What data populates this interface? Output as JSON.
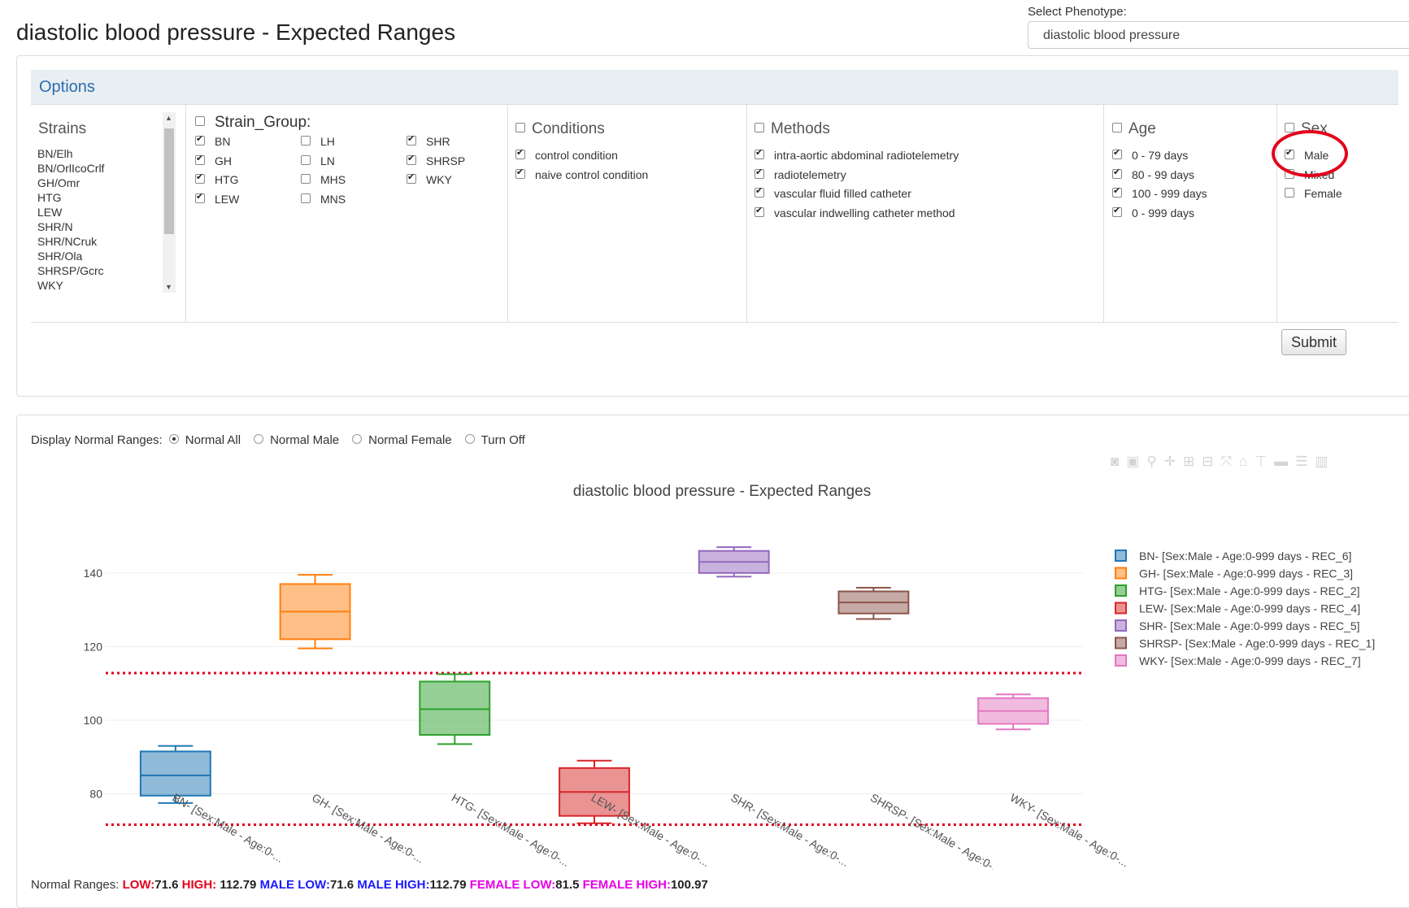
{
  "header": {
    "title": "diastolic blood pressure - Expected Ranges",
    "phenotype_label": "Select Phenotype:",
    "phenotype_value": "diastolic blood pressure",
    "caret": "▼"
  },
  "options": {
    "title": "Options",
    "strains": {
      "title": "Strains",
      "items": [
        "BN/Elh",
        "BN/OrlIcoCrlf",
        "GH/Omr",
        "HTG",
        "LEW",
        "SHR/N",
        "SHR/NCruk",
        "SHR/Ola",
        "SHRSP/Gcrc",
        "WKY"
      ]
    },
    "strain_group": {
      "title": "Strain_Group:",
      "checked": false,
      "items": [
        {
          "label": "BN",
          "checked": true
        },
        {
          "label": "GH",
          "checked": true
        },
        {
          "label": "HTG",
          "checked": true
        },
        {
          "label": "LEW",
          "checked": true
        },
        {
          "label": "LH",
          "checked": false
        },
        {
          "label": "LN",
          "checked": false
        },
        {
          "label": "MHS",
          "checked": false
        },
        {
          "label": "MNS",
          "checked": false
        },
        {
          "label": "SHR",
          "checked": true
        },
        {
          "label": "SHRSP",
          "checked": true
        },
        {
          "label": "WKY",
          "checked": true
        }
      ]
    },
    "conditions": {
      "title": "Conditions",
      "checked": false,
      "items": [
        {
          "label": "control condition",
          "checked": true
        },
        {
          "label": "naive control condition",
          "checked": true
        }
      ]
    },
    "methods": {
      "title": "Methods",
      "checked": false,
      "items": [
        {
          "label": "intra-aortic abdominal radiotelemetry",
          "checked": true
        },
        {
          "label": "radiotelemetry",
          "checked": true
        },
        {
          "label": "vascular fluid filled catheter",
          "checked": true
        },
        {
          "label": "vascular indwelling catheter method",
          "checked": true
        }
      ]
    },
    "age": {
      "title": "Age",
      "checked": false,
      "items": [
        {
          "label": "0 - 79 days",
          "checked": true
        },
        {
          "label": "80 - 99 days",
          "checked": true
        },
        {
          "label": "100 - 999 days",
          "checked": true
        },
        {
          "label": "0 - 999 days",
          "checked": true
        }
      ]
    },
    "sex": {
      "title": "Sex",
      "checked": false,
      "items": [
        {
          "label": "Male",
          "checked": true
        },
        {
          "label": "Mixed",
          "checked": false
        },
        {
          "label": "Female",
          "checked": false
        }
      ]
    },
    "submit_label": "Submit"
  },
  "display": {
    "label": "Display Normal Ranges:",
    "options": [
      {
        "label": "Normal All",
        "selected": true
      },
      {
        "label": "Normal Male",
        "selected": false
      },
      {
        "label": "Normal Female",
        "selected": false
      },
      {
        "label": "Turn Off",
        "selected": false
      }
    ]
  },
  "modebar_icons": [
    "camera-icon",
    "save-icon",
    "zoom-icon",
    "pan-icon",
    "zoom-in-icon",
    "zoom-out-icon",
    "autoscale-icon",
    "home-icon",
    "spike-icon",
    "hover-closest-icon",
    "hover-compare-icon",
    "plotly-logo-icon"
  ],
  "chart_data": {
    "type": "box",
    "title": "diastolic blood pressure - Expected Ranges",
    "y_ticks": [
      80,
      100,
      120,
      140
    ],
    "ylim": [
      62,
      153
    ],
    "grid": true,
    "legend_position": "right",
    "reference_lines": [
      {
        "name": "HIGH",
        "value": 112.79,
        "color": "#e3001b",
        "style": "dotted"
      },
      {
        "name": "LOW",
        "value": 71.6,
        "color": "#e3001b",
        "style": "dotted"
      }
    ],
    "series": [
      {
        "name": "BN- [Sex:Male - Age:0-999 days - REC_6]",
        "tick": "BN- [Sex:Male - Age:0-...",
        "color": "#1f77b4",
        "min": 77.5,
        "q1": 79.5,
        "median": 85,
        "q3": 91.5,
        "max": 93
      },
      {
        "name": "GH- [Sex:Male - Age:0-999 days - REC_3]",
        "tick": "GH- [Sex:Male - Age:0-...",
        "color": "#ff7f0e",
        "min": 119.5,
        "q1": 122,
        "median": 129.5,
        "q3": 137,
        "max": 139.5
      },
      {
        "name": "HTG- [Sex:Male - Age:0-999 days - REC_2]",
        "tick": "HTG- [Sex:Male - Age:0-...",
        "color": "#2ca02c",
        "min": 93.5,
        "q1": 96,
        "median": 103,
        "q3": 110.5,
        "max": 112.5
      },
      {
        "name": "LEW- [Sex:Male - Age:0-999 days - REC_4]",
        "tick": "LEW- [Sex:Male - Age:0-...",
        "color": "#d62728",
        "min": 72,
        "q1": 74,
        "median": 80.5,
        "q3": 87,
        "max": 89
      },
      {
        "name": "SHR- [Sex:Male - Age:0-999 days - REC_5]",
        "tick": "SHR- [Sex:Male - Age:0-...",
        "color": "#9467bd",
        "min": 139,
        "q1": 140,
        "median": 143,
        "q3": 146,
        "max": 147
      },
      {
        "name": "SHRSP- [Sex:Male - Age:0-999 days - REC_1]",
        "tick": "SHRSP- [Sex:Male - Age:0-...",
        "color": "#8c564b",
        "min": 127.5,
        "q1": 129,
        "median": 132,
        "q3": 135,
        "max": 136
      },
      {
        "name": "WKY- [Sex:Male - Age:0-999 days - REC_7]",
        "tick": "WKY- [Sex:Male - Age:0-...",
        "color": "#e377c2",
        "min": 97.5,
        "q1": 99,
        "median": 102.5,
        "q3": 106,
        "max": 107
      }
    ]
  },
  "footer": {
    "label": "Normal Ranges:",
    "low_label": "LOW:",
    "low_value": "71.6",
    "high_label": "HIGH:",
    "high_value": "112.79",
    "male_low_label": "MALE LOW:",
    "male_low_value": "71.6",
    "male_high_label": "MALE HIGH:",
    "male_high_value": "112.79",
    "female_low_label": "FEMALE LOW:",
    "female_low_value": "81.5",
    "female_high_label": "FEMALE HIGH:",
    "female_high_value": "100.97"
  }
}
